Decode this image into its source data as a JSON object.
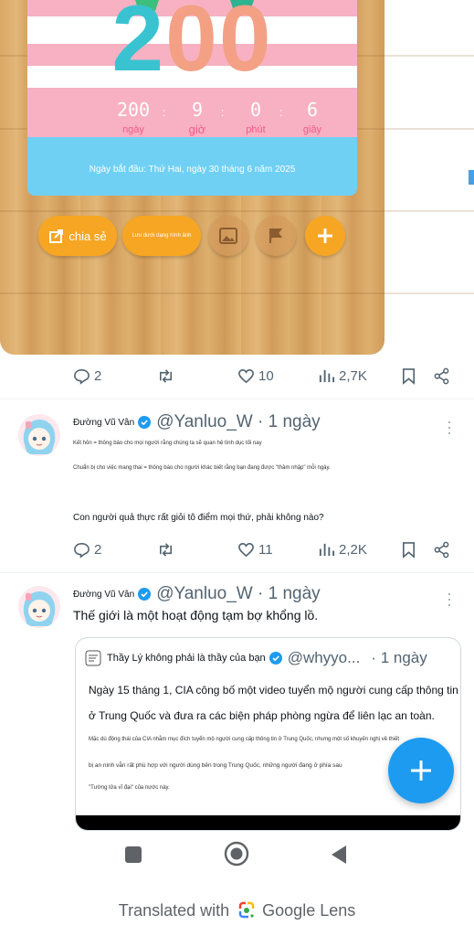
{
  "poster": {
    "big_number": "200",
    "count_days": "200",
    "count_hours": "9",
    "count_minutes": "0",
    "count_seconds": "6",
    "unit_days": "ngày",
    "unit_hours": "giờ",
    "unit_minutes": "phút",
    "unit_seconds": "giây",
    "start_date": "Ngày bắt đầu: Thứ Hai, ngày 30 tháng 6 năm 2025",
    "share_label": "chia sẻ",
    "save_image_label": "Lưu dưới dạng hình ảnh"
  },
  "tweet0": {
    "replies": "2",
    "likes": "10",
    "views": "2,7K"
  },
  "tweet1": {
    "name": "Đường Vũ Vân",
    "handle": "@Yanluo_W · 1 ngày",
    "line1": "Kết hôn = thông báo cho mọi người rằng chúng ta sẽ quan hệ tình dục tối nay",
    "line2": "Chuẩn bị cho việc mang thai = thông báo cho người khác biết rằng bạn đang được \"thâm nhập\" mỗi ngày.",
    "line3": "Con người quả thực rất giỏi tô điểm mọi thứ, phải không nào?",
    "replies": "2",
    "likes": "11",
    "views": "2,2K"
  },
  "tweet2": {
    "name": "Đường Vũ Vân",
    "handle": "@Yanluo_W · 1 ngày",
    "text": "Thế giới là một hoạt động tạm bợ khổng lồ.",
    "quote": {
      "name": "Thầy Lý không phải là thầy của bạn",
      "handle": "@whyyo...",
      "time": "· 1 ngày",
      "line1": "Ngày 15 tháng 1, CIA công bố một video tuyển mộ người cung cấp thông tin",
      "line2": "ở Trung Quốc và đưa ra các biện pháp phòng ngừa để liên lạc an toàn.",
      "line3": "Mặc dù động thái của CIA nhằm mục đích tuyển mộ người cung cấp thông tin ở Trung Quốc, nhưng một số khuyến nghị về thiết",
      "line4": "bị an ninh vẫn rất phù hợp với người dùng bên trong Trung Quốc, những người đang ở phía sau",
      "line5": "\"Tường lửa vĩ đại\" của nước này."
    }
  },
  "footer": {
    "lens_prefix": "Translated with",
    "lens_brand": "Google Lens"
  },
  "colors": {
    "accent": "#1d9bf0",
    "orange": "#f6a623",
    "pink": "#f7b1c2",
    "sky": "#6fd0f4"
  },
  "icons": [
    "reply-icon",
    "retweet-icon",
    "like-icon",
    "views-icon",
    "bookmark-icon",
    "share-icon",
    "verified-icon",
    "more-icon",
    "compose-icon"
  ]
}
